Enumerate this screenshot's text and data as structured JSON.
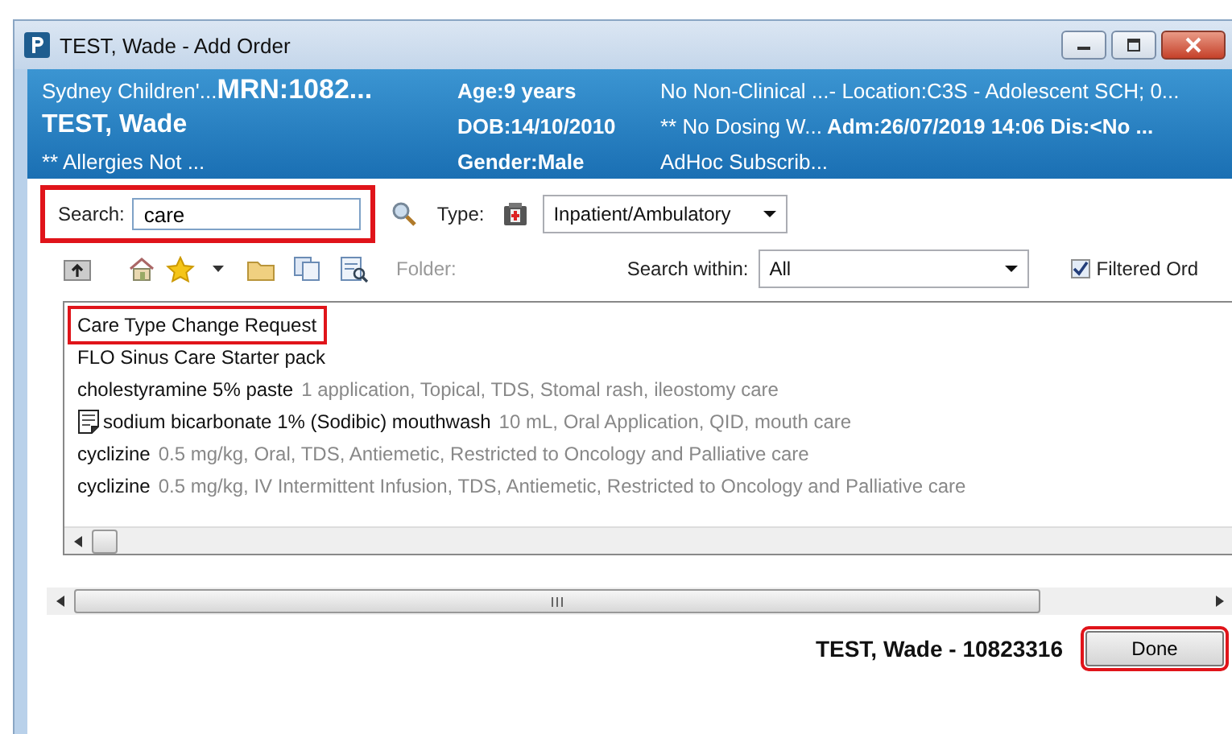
{
  "window": {
    "title": "TEST, Wade - Add Order"
  },
  "banner": {
    "facility": "Sydney Children'...",
    "mrn": "MRN:1082...",
    "name": "TEST, Wade",
    "allergies": "** Allergies Not ...",
    "age": "Age:9 years",
    "dob": "DOB:14/10/2010",
    "gender": "Gender:Male",
    "clinical": "No Non-Clinical ...",
    "dosing": "** No Dosing W...",
    "subscription": "AdHoc Subscrib...",
    "location": "- Location:C3S - Adolescent SCH; 0...",
    "admission": "Adm:26/07/2019 14:06 Dis:<No ..."
  },
  "search": {
    "label": "Search:",
    "value": "care",
    "highlighted": true
  },
  "type": {
    "label": "Type:",
    "value": "Inpatient/Ambulatory"
  },
  "toolbar": {
    "folder_label": "Folder:",
    "search_within_label": "Search within:",
    "search_within_value": "All",
    "filtered": {
      "label": "Filtered Ord",
      "checked": true
    }
  },
  "results": [
    {
      "name": "Care Type Change Request",
      "kind": "plain",
      "highlighted": true
    },
    {
      "name": "FLO Sinus Care Starter pack",
      "kind": "plain",
      "highlighted": false
    },
    {
      "name": "cholestyramine 5% paste",
      "detail": "1 application, Topical, TDS, Stomal rash, ileostomy care",
      "kind": "plain",
      "highlighted": false
    },
    {
      "name": "sodium bicarbonate 1% (Sodibic) mouthwash",
      "detail": "10 mL, Oral Application, QID, mouth care",
      "kind": "note",
      "highlighted": false
    },
    {
      "name": "cyclizine",
      "detail": "0.5 mg/kg, Oral, TDS, Antiemetic, Restricted to Oncology and Palliative care",
      "kind": "plain",
      "highlighted": false
    },
    {
      "name": "cyclizine",
      "detail": "0.5 mg/kg, IV Intermittent Infusion, TDS, Antiemetic, Restricted to Oncology and Palliative care",
      "kind": "plain",
      "highlighted": false
    }
  ],
  "footer": {
    "patient": "TEST, Wade - 10823316",
    "done": {
      "label": "Done",
      "highlighted": true
    }
  }
}
